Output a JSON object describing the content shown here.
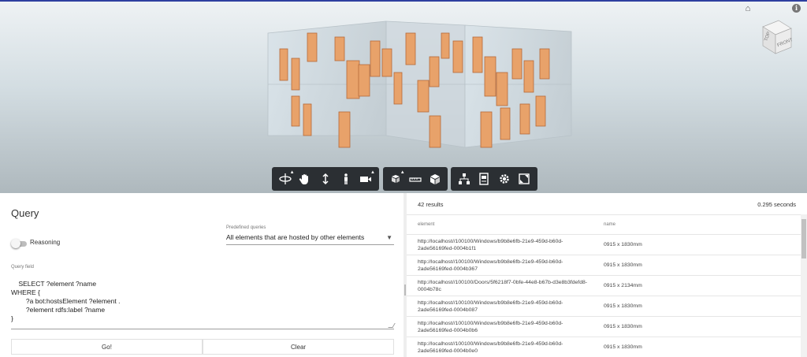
{
  "viewer": {
    "cube_top_label": "TOP",
    "cube_front_label": "FRONT",
    "info_glyph": "i",
    "toolbar_groups": [
      [
        "orbit-icon",
        "pan-icon",
        "zoom-icon",
        "first-person-icon",
        "camera-icon"
      ],
      [
        "explode-model-icon",
        "measure-icon",
        "section-box-icon"
      ],
      [
        "model-browser-icon",
        "properties-icon",
        "settings-icon",
        "fullscreen-icon"
      ]
    ],
    "colors": {
      "toolbar": "#2b2f33",
      "top_border": "#2d3fa0",
      "window_frame": "#e8a26a"
    }
  },
  "query": {
    "title": "Query",
    "reasoning_label": "Reasoning",
    "reasoning_on": false,
    "predefined_label": "Predefined queries",
    "predefined_value": "All elements that are hosted by other elements",
    "field_label": "Query field",
    "field_value": "SELECT ?element ?name\nWHERE {\n        ?a bot:hostsElement ?element .\n        ?element rdfs:label ?name\n}",
    "go_label": "Go!",
    "clear_label": "Clear"
  },
  "results": {
    "count_text": "42 results",
    "time_text": "0.295 seconds",
    "columns": [
      "element",
      "name"
    ],
    "rows": [
      {
        "element": "http://localhost//100100/Windows/b9b8e6fb-21e9-459d-b60d-2ade56169fed-0004b1f1",
        "name": "0915 x 1830mm"
      },
      {
        "element": "http://localhost//100100/Windows/b9b8e6fb-21e9-459d-b60d-2ade56169fed-0004b367",
        "name": "0915 x 1830mm"
      },
      {
        "element": "http://localhost//100100/Doors/5f6218f7-0bfe-44e8-b67b-d3e8b3fdefd8-0004b78c",
        "name": "0915 x 2134mm"
      },
      {
        "element": "http://localhost//100100/Windows/b9b8e6fb-21e9-459d-b60d-2ade56169fed-0004b087",
        "name": "0915 x 1830mm"
      },
      {
        "element": "http://localhost//100100/Windows/b9b8e6fb-21e9-459d-b60d-2ade56169fed-0004b0b6",
        "name": "0915 x 1830mm"
      },
      {
        "element": "http://localhost//100100/Windows/b9b8e6fb-21e9-459d-b60d-2ade56169fed-0004b0e0",
        "name": "0915 x 1830mm"
      }
    ]
  }
}
